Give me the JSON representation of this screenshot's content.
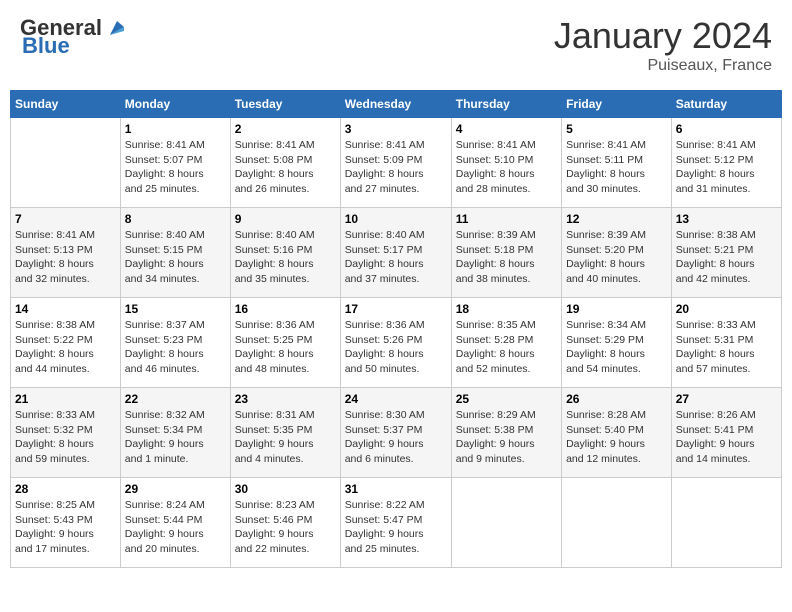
{
  "header": {
    "logo_general": "General",
    "logo_blue": "Blue",
    "month_title": "January 2024",
    "subtitle": "Puiseaux, France"
  },
  "columns": [
    "Sunday",
    "Monday",
    "Tuesday",
    "Wednesday",
    "Thursday",
    "Friday",
    "Saturday"
  ],
  "weeks": [
    [
      {
        "day": "",
        "info": ""
      },
      {
        "day": "1",
        "info": "Sunrise: 8:41 AM\nSunset: 5:07 PM\nDaylight: 8 hours\nand 25 minutes."
      },
      {
        "day": "2",
        "info": "Sunrise: 8:41 AM\nSunset: 5:08 PM\nDaylight: 8 hours\nand 26 minutes."
      },
      {
        "day": "3",
        "info": "Sunrise: 8:41 AM\nSunset: 5:09 PM\nDaylight: 8 hours\nand 27 minutes."
      },
      {
        "day": "4",
        "info": "Sunrise: 8:41 AM\nSunset: 5:10 PM\nDaylight: 8 hours\nand 28 minutes."
      },
      {
        "day": "5",
        "info": "Sunrise: 8:41 AM\nSunset: 5:11 PM\nDaylight: 8 hours\nand 30 minutes."
      },
      {
        "day": "6",
        "info": "Sunrise: 8:41 AM\nSunset: 5:12 PM\nDaylight: 8 hours\nand 31 minutes."
      }
    ],
    [
      {
        "day": "7",
        "info": "Sunrise: 8:41 AM\nSunset: 5:13 PM\nDaylight: 8 hours\nand 32 minutes."
      },
      {
        "day": "8",
        "info": "Sunrise: 8:40 AM\nSunset: 5:15 PM\nDaylight: 8 hours\nand 34 minutes."
      },
      {
        "day": "9",
        "info": "Sunrise: 8:40 AM\nSunset: 5:16 PM\nDaylight: 8 hours\nand 35 minutes."
      },
      {
        "day": "10",
        "info": "Sunrise: 8:40 AM\nSunset: 5:17 PM\nDaylight: 8 hours\nand 37 minutes."
      },
      {
        "day": "11",
        "info": "Sunrise: 8:39 AM\nSunset: 5:18 PM\nDaylight: 8 hours\nand 38 minutes."
      },
      {
        "day": "12",
        "info": "Sunrise: 8:39 AM\nSunset: 5:20 PM\nDaylight: 8 hours\nand 40 minutes."
      },
      {
        "day": "13",
        "info": "Sunrise: 8:38 AM\nSunset: 5:21 PM\nDaylight: 8 hours\nand 42 minutes."
      }
    ],
    [
      {
        "day": "14",
        "info": "Sunrise: 8:38 AM\nSunset: 5:22 PM\nDaylight: 8 hours\nand 44 minutes."
      },
      {
        "day": "15",
        "info": "Sunrise: 8:37 AM\nSunset: 5:23 PM\nDaylight: 8 hours\nand 46 minutes."
      },
      {
        "day": "16",
        "info": "Sunrise: 8:36 AM\nSunset: 5:25 PM\nDaylight: 8 hours\nand 48 minutes."
      },
      {
        "day": "17",
        "info": "Sunrise: 8:36 AM\nSunset: 5:26 PM\nDaylight: 8 hours\nand 50 minutes."
      },
      {
        "day": "18",
        "info": "Sunrise: 8:35 AM\nSunset: 5:28 PM\nDaylight: 8 hours\nand 52 minutes."
      },
      {
        "day": "19",
        "info": "Sunrise: 8:34 AM\nSunset: 5:29 PM\nDaylight: 8 hours\nand 54 minutes."
      },
      {
        "day": "20",
        "info": "Sunrise: 8:33 AM\nSunset: 5:31 PM\nDaylight: 8 hours\nand 57 minutes."
      }
    ],
    [
      {
        "day": "21",
        "info": "Sunrise: 8:33 AM\nSunset: 5:32 PM\nDaylight: 8 hours\nand 59 minutes."
      },
      {
        "day": "22",
        "info": "Sunrise: 8:32 AM\nSunset: 5:34 PM\nDaylight: 9 hours\nand 1 minute."
      },
      {
        "day": "23",
        "info": "Sunrise: 8:31 AM\nSunset: 5:35 PM\nDaylight: 9 hours\nand 4 minutes."
      },
      {
        "day": "24",
        "info": "Sunrise: 8:30 AM\nSunset: 5:37 PM\nDaylight: 9 hours\nand 6 minutes."
      },
      {
        "day": "25",
        "info": "Sunrise: 8:29 AM\nSunset: 5:38 PM\nDaylight: 9 hours\nand 9 minutes."
      },
      {
        "day": "26",
        "info": "Sunrise: 8:28 AM\nSunset: 5:40 PM\nDaylight: 9 hours\nand 12 minutes."
      },
      {
        "day": "27",
        "info": "Sunrise: 8:26 AM\nSunset: 5:41 PM\nDaylight: 9 hours\nand 14 minutes."
      }
    ],
    [
      {
        "day": "28",
        "info": "Sunrise: 8:25 AM\nSunset: 5:43 PM\nDaylight: 9 hours\nand 17 minutes."
      },
      {
        "day": "29",
        "info": "Sunrise: 8:24 AM\nSunset: 5:44 PM\nDaylight: 9 hours\nand 20 minutes."
      },
      {
        "day": "30",
        "info": "Sunrise: 8:23 AM\nSunset: 5:46 PM\nDaylight: 9 hours\nand 22 minutes."
      },
      {
        "day": "31",
        "info": "Sunrise: 8:22 AM\nSunset: 5:47 PM\nDaylight: 9 hours\nand 25 minutes."
      },
      {
        "day": "",
        "info": ""
      },
      {
        "day": "",
        "info": ""
      },
      {
        "day": "",
        "info": ""
      }
    ]
  ]
}
